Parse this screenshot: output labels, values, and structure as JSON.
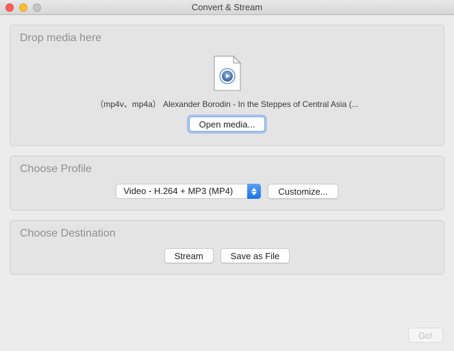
{
  "window": {
    "title": "Convert & Stream"
  },
  "drop": {
    "heading": "Drop media here",
    "file_line": "（mp4v、mp4a） Alexander Borodin - In the Steppes of Central Asia (...",
    "open_media_label": "Open media..."
  },
  "profile": {
    "heading": "Choose Profile",
    "selected": "Video - H.264 + MP3 (MP4)",
    "customize_label": "Customize..."
  },
  "destination": {
    "heading": "Choose Destination",
    "stream_label": "Stream",
    "save_label": "Save as File"
  },
  "go": {
    "label": "Go!"
  }
}
